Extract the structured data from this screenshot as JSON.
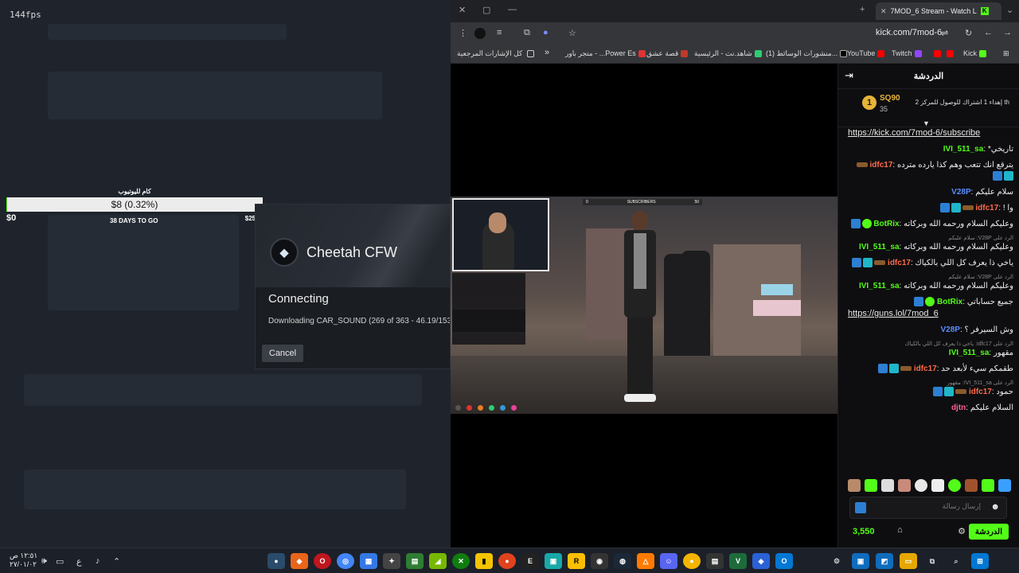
{
  "overlay": {
    "fps": "144fps"
  },
  "goal_widget": {
    "title": "كام لليوتيوب",
    "amount_text": "$8 (0.32%)",
    "progress_fraction": 0.0032,
    "min_label": "$0",
    "days_label": "38 DAYS TO GO",
    "max_label": "$2500"
  },
  "dialog": {
    "app_name": "Cheetah CFW",
    "status": "Connecting",
    "progress_text": "Downloading CAR_SOUND (269 of 363 - 46.19/153.",
    "cancel_label": "Cancel"
  },
  "browser": {
    "tab_title": "7MOD_6 Stream - Watch L",
    "url": "kick.com/7mod-6",
    "bookmarks": [
      "Kick",
      "Twitch",
      "YouTube",
      "(1) منشورات الوسائط...",
      "شاهد.نت - الرئيسية",
      "قصة عشق",
      "متجر باور - ...Power Es"
    ],
    "all_bookmarks": "كل الإشارات المرجعية",
    "more": "»"
  },
  "stream": {
    "hud_left": "0",
    "hud_mid": "SUBSCRIBERS",
    "hud_right": "50"
  },
  "chat": {
    "title": "الدردشة",
    "pinned": {
      "rank": "1",
      "user": "SQ90",
      "count": "35",
      "text": "إهداء 1 اشتراك للوصول للمركز 2 th"
    },
    "messages": [
      {
        "link": "https://kick.com/7mod-6/subscribe"
      },
      {
        "user": "IVI_511_sa",
        "color": "#53fc18",
        "text": "تاريخي*"
      },
      {
        "user": "idfc17",
        "color": "#ff6b4a",
        "text": "يترقع انك تتعب وهم كذا يارده مترده"
      },
      {
        "user": "V28P",
        "color": "#5a8dff",
        "text": "سلام عليكم"
      },
      {
        "user": "idfc17",
        "color": "#ff6b4a",
        "text": "وا !"
      },
      {
        "user": "BotRix",
        "color": "#53fc18",
        "text": "وعليكم السلام ورحمه الله وبركاته"
      },
      {
        "reply": "الرد على V28P: سلام عليكم",
        "user": "IVI_511_sa",
        "color": "#53fc18",
        "text": "وعليكم السلام ورحمه الله وبركاته"
      },
      {
        "user": "idfc17",
        "color": "#ff6b4a",
        "text": "ياخي ذا يعرف كل اللي بالكياك"
      },
      {
        "reply": "الرد على V28P: سلام عليكم",
        "user": "IVI_511_sa",
        "color": "#53fc18",
        "text": "وعليكم السلام ورحمه الله وبركاته"
      },
      {
        "user": "BotRix",
        "color": "#53fc18",
        "text": "جميع حساباتي",
        "link": "https://guns.lol/7mod_6"
      },
      {
        "user": "V28P",
        "color": "#5a8dff",
        "text": "وش السيرفر ؟"
      },
      {
        "reply": "الرد على idfc17: ياخي ذا يعرف كل اللي بالكياك",
        "user": "IVI_511_sa",
        "color": "#53fc18",
        "text": "مقهور"
      },
      {
        "user": "idfc17",
        "color": "#ff6b4a",
        "text": "طقمكم سيء لأبعد حد"
      },
      {
        "reply": "الرد على IVI_511_sa: مقهور",
        "user": "idfc17",
        "color": "#ff6b4a",
        "text": "حمود"
      },
      {
        "user": "djtn",
        "color": "#ff5a9a",
        "text": "السلام عليكم"
      }
    ],
    "input_placeholder": "إرسال رسالة",
    "send_label": "الدردشة",
    "points": "3,550"
  },
  "taskbar": {
    "time": "١٢:٥١ ص",
    "date": "٢٧/٠١/٠٢",
    "lang": "ع"
  }
}
